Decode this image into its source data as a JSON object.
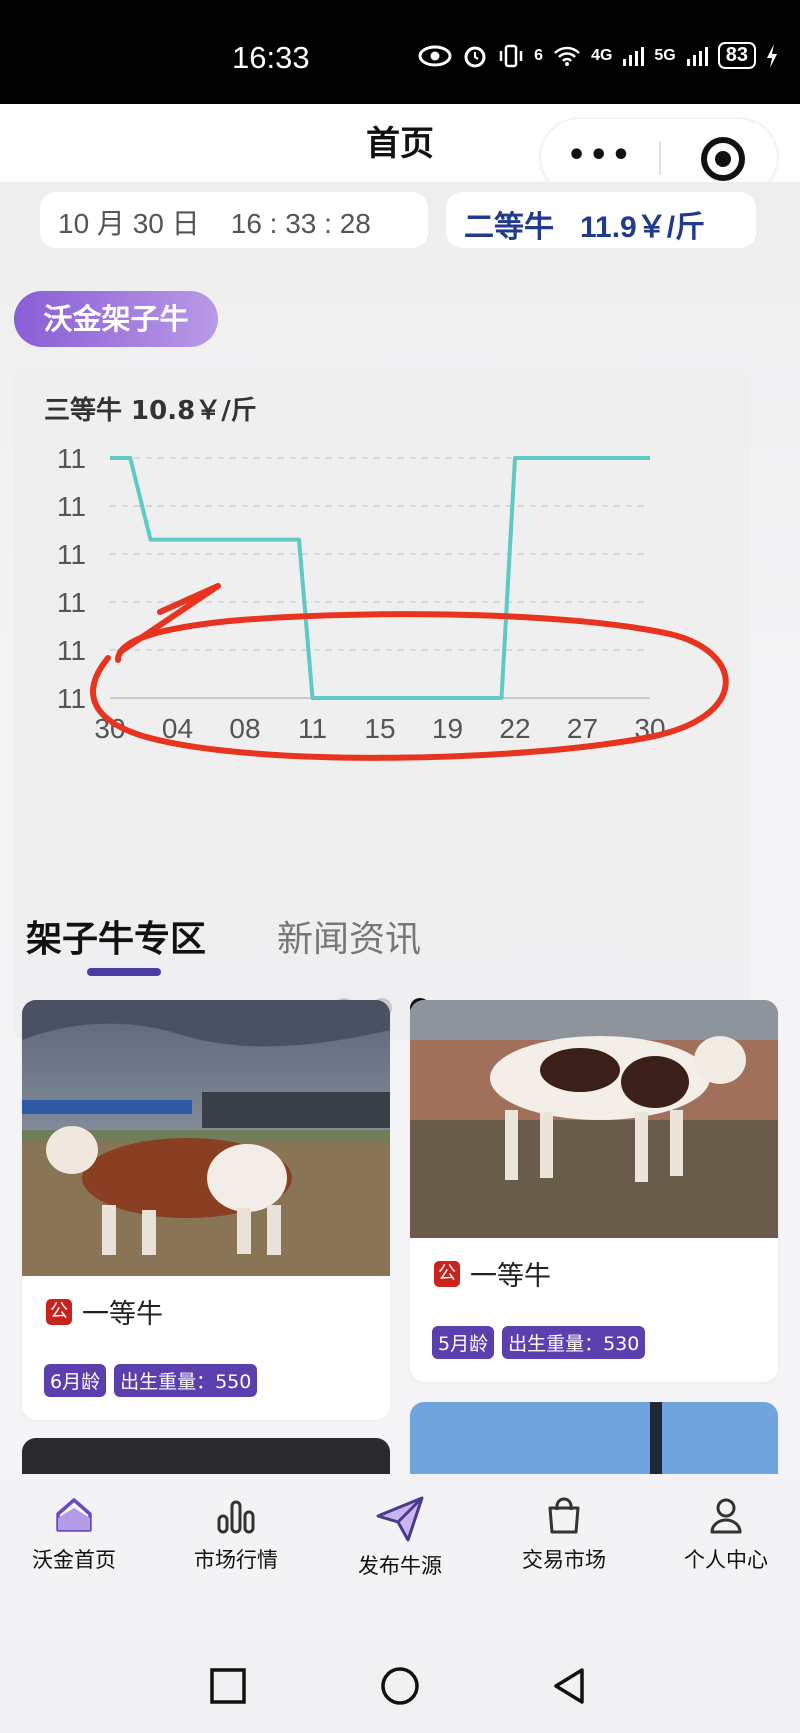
{
  "status_bar": {
    "time": "16:33",
    "signal_4g": "4G",
    "signal_5g": "5G",
    "wifi_6": "6",
    "battery": "83"
  },
  "header": {
    "title": "首页",
    "capsule_more": "•••"
  },
  "info_bar": {
    "date_time": "10 月 30 日    16 : 33 : 28",
    "price_grade": "二等牛",
    "price_value": "11.9￥/斤"
  },
  "region_badge": "沃金架子牛",
  "chart_card": {
    "title": "三等牛 10.8￥/斤",
    "pager": {
      "total": 3,
      "active": 2
    }
  },
  "chart_data": {
    "type": "line",
    "title": "三等牛 10.8￥/斤",
    "xlabel": "",
    "ylabel": "",
    "x_tick_labels": [
      "30",
      "04",
      "08",
      "11",
      "15",
      "19",
      "22",
      "27",
      "30"
    ],
    "y_tick_labels": [
      "11",
      "11",
      "11",
      "11",
      "11",
      "11"
    ],
    "ylim": [
      0,
      5
    ],
    "grid": true,
    "series_color": "#5fc9c3",
    "series": [
      {
        "x": [
          0,
          0.3,
          0.6,
          2.8,
          3.0,
          5.8,
          6.0,
          8.0
        ],
        "values": [
          5,
          5,
          3.3,
          3.3,
          0,
          0,
          5,
          5
        ]
      }
    ]
  },
  "annotation": {
    "color": "#e8331f"
  },
  "section_tabs": [
    {
      "label": "架子牛专区",
      "active": true
    },
    {
      "label": "新闻资讯",
      "active": false
    }
  ],
  "cards": [
    {
      "sex": "公",
      "grade": "一等牛",
      "age": "6月龄",
      "weight": "出生重量：550"
    },
    {
      "sex": "公",
      "grade": "一等牛",
      "age": "5月龄",
      "weight": "出生重量：530"
    }
  ],
  "bottom_nav": [
    {
      "label": "沃金首页",
      "icon": "home-icon"
    },
    {
      "label": "市场行情",
      "icon": "bar-chart-icon"
    },
    {
      "label": "发布牛源",
      "icon": "send-icon"
    },
    {
      "label": "交易市场",
      "icon": "bag-icon"
    },
    {
      "label": "个人中心",
      "icon": "user-icon"
    }
  ],
  "colors": {
    "accent": "#203a8c",
    "badge_gradient_start": "#8a5dd6",
    "tag_bg": "#5b3fae",
    "nav_accent": "#6a4bc4"
  }
}
